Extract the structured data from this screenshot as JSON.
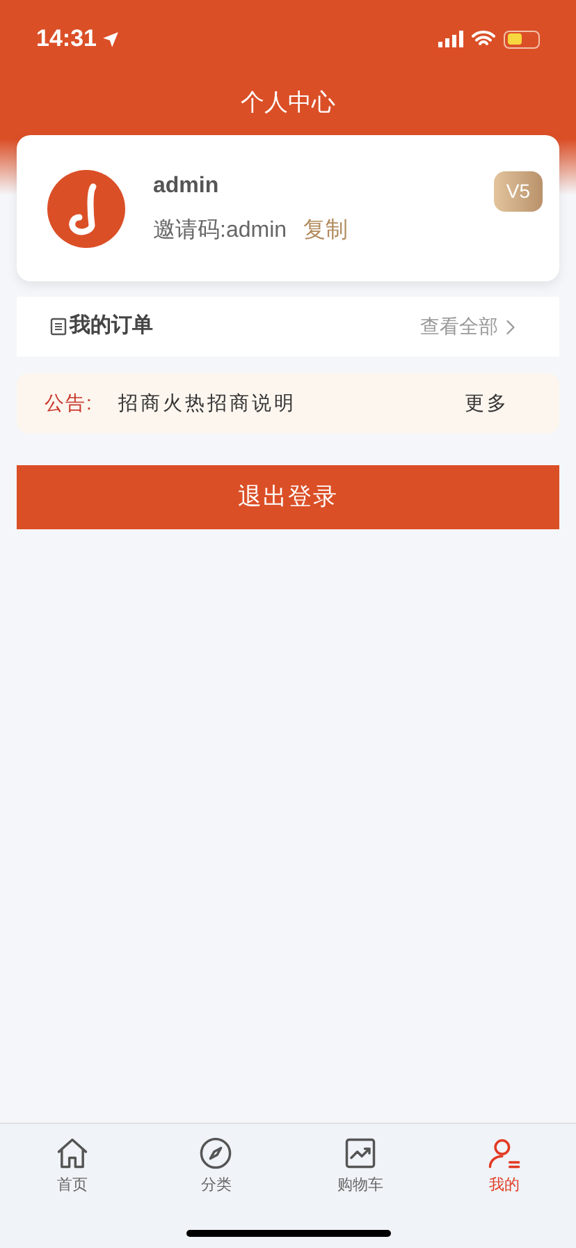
{
  "status_bar": {
    "time": "14:31"
  },
  "header": {
    "title": "个人中心"
  },
  "profile": {
    "username": "admin",
    "invite_label": "邀请码:admin",
    "copy_label": "复制",
    "vip_badge": "V5"
  },
  "orders": {
    "title": "我的订单",
    "view_all": "查看全部"
  },
  "notice": {
    "label": "公告:",
    "text": "招商火热招商说明",
    "more": "更多"
  },
  "logout_button": "退出登录",
  "tab_bar": [
    {
      "kind": "home",
      "label": "首页",
      "selected": false
    },
    {
      "kind": "compass",
      "label": "分类",
      "selected": false
    },
    {
      "kind": "chart",
      "label": "购物车",
      "selected": false
    },
    {
      "kind": "user",
      "label": "我的",
      "selected": true
    }
  ]
}
